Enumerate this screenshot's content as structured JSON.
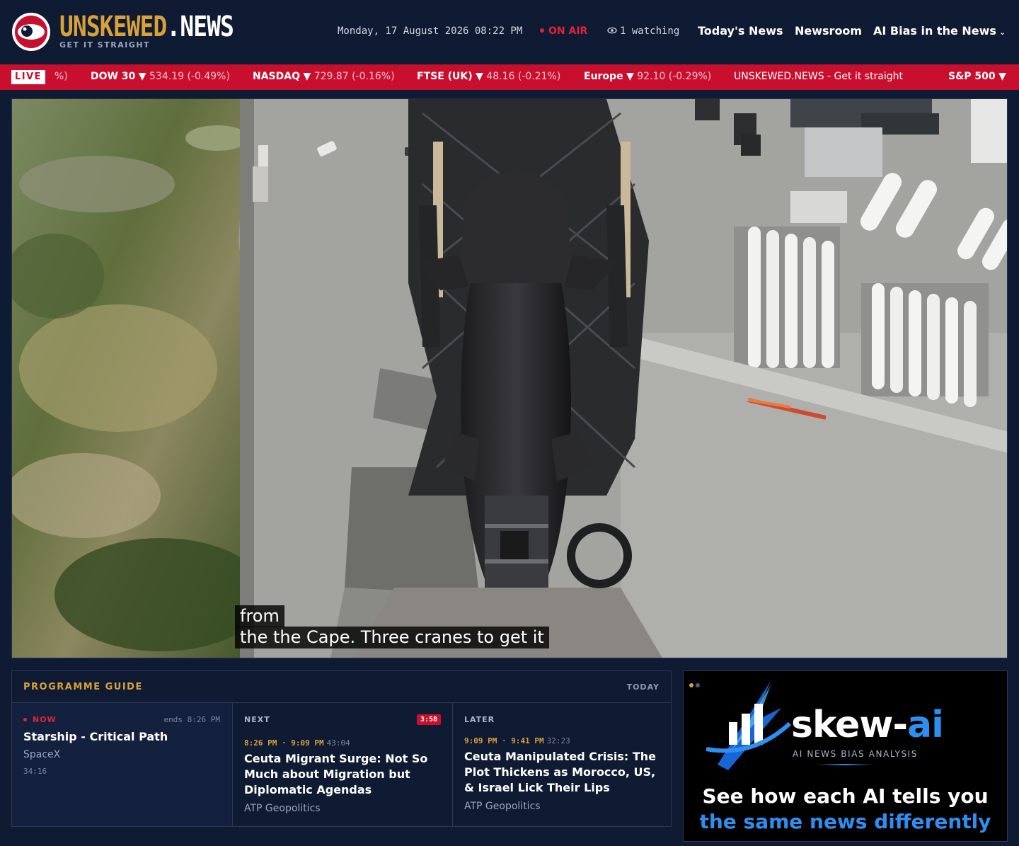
{
  "header": {
    "brand_part1": "UNSKEWED",
    "brand_part2": ".NEWS",
    "tagline": "GET IT STRAIGHT",
    "datetime": "Monday, 17 August 2026 08:22 PM",
    "on_air": "ON AIR",
    "watching": "1 watching",
    "nav": [
      {
        "label": "Today's News"
      },
      {
        "label": "Newsroom"
      },
      {
        "label": "AI Bias in the News",
        "has_dropdown": true
      }
    ]
  },
  "ticker": {
    "live_label": "LIVE",
    "items": [
      {
        "name": "",
        "arrow": "",
        "value": "%)"
      },
      {
        "name": "DOW 30",
        "arrow": "▼",
        "value": "534.19 (-0.49%)"
      },
      {
        "name": "NASDAQ",
        "arrow": "▼",
        "value": "729.87 (-0.16%)"
      },
      {
        "name": "FTSE (UK)",
        "arrow": "▼",
        "value": "48.16 (-0.21%)"
      },
      {
        "name": "Europe",
        "arrow": "▼",
        "value": "92.10 (-0.29%)"
      },
      {
        "name": "",
        "arrow": "",
        "value": "UNSKEWED.NEWS - Get it straight"
      },
      {
        "name": "S&P 500",
        "arrow": "▼",
        "value": ""
      }
    ]
  },
  "video": {
    "caption_line1": "from",
    "caption_line2": "the the Cape. Three cranes to get it"
  },
  "guide": {
    "title": "PROGRAMME GUIDE",
    "today": "TODAY",
    "now": {
      "label": "NOW",
      "ends": "ends 8:26 PM",
      "title": "Starship - Critical Path",
      "source": "SpaceX",
      "duration": "34:16"
    },
    "next": {
      "label": "NEXT",
      "countdown": "3:58",
      "time": "8:26 PM · 9:09 PM",
      "duration": "43:04",
      "title": "Ceuta Migrant Surge: Not So Much about Migration but Diplomatic Agendas",
      "source": "ATP Geopolitics"
    },
    "later": {
      "label": "LATER",
      "time": "9:09 PM · 9:41 PM",
      "duration": "32:23",
      "title": "Ceuta Manipulated Crisis: The Plot Thickens as Morocco, US, & Israel Lick Their Lips",
      "source": "ATP Geopolitics"
    }
  },
  "ad": {
    "brand_main": "skew-",
    "brand_accent": "ai",
    "subtitle": "AI NEWS BIAS ANALYSIS",
    "line1": "See how each AI tells you",
    "line2": "the same news differently"
  },
  "colors": {
    "background": "#0f1b33",
    "accent_gold": "#d9a13a",
    "live_red": "#c8102e",
    "ad_blue": "#2f8ff0"
  }
}
